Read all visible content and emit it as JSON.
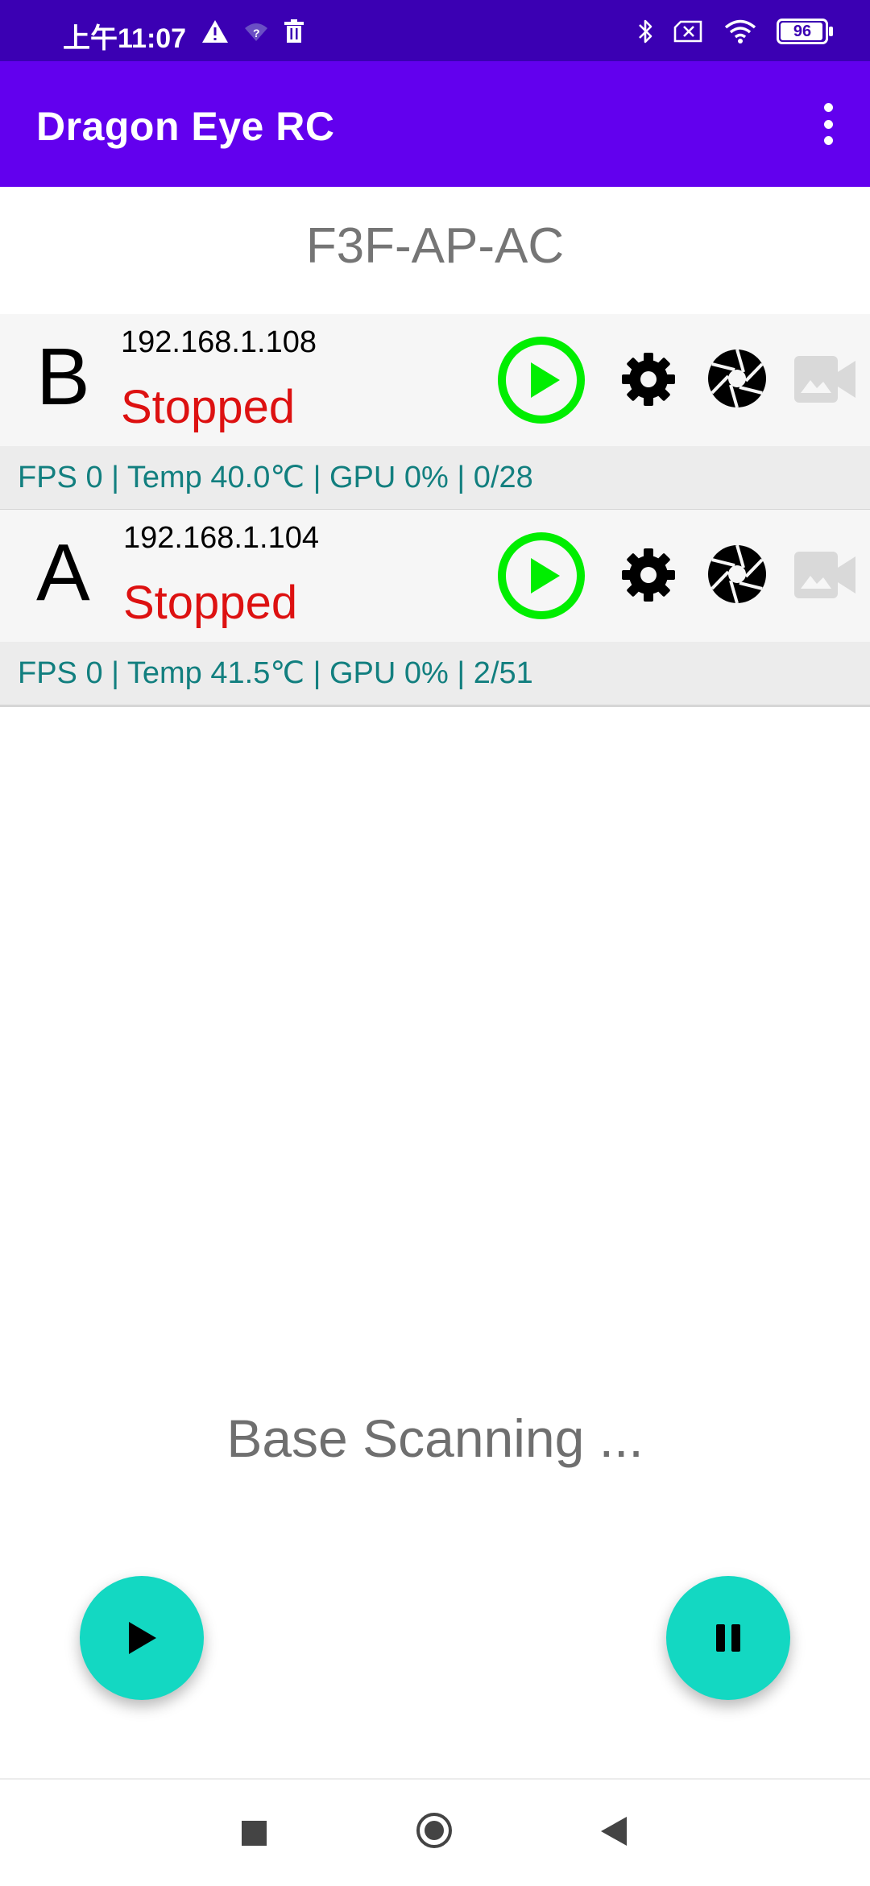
{
  "status_bar": {
    "time": "上午11:07",
    "battery": "96"
  },
  "app_bar": {
    "title": "Dragon Eye RC"
  },
  "network_name": "F3F-AP-AC",
  "devices": [
    {
      "letter": "B",
      "ip": "192.168.1.108",
      "status": "Stopped",
      "stats": "FPS 0 | Temp 40.0℃ | GPU 0% | 0/28"
    },
    {
      "letter": "A",
      "ip": "192.168.1.104",
      "status": "Stopped",
      "stats": "FPS 0 | Temp 41.5℃ | GPU 0% | 2/51"
    }
  ],
  "scan_status": "Base Scanning ...",
  "colors": {
    "status_bar": "#3b00b3",
    "app_bar": "#6200ee",
    "status_stopped": "#dd1111",
    "play_green": "#00ee00",
    "stats_teal": "#127f7f",
    "fab": "#13d8c2"
  },
  "icons": {
    "device_actions": [
      "play-circle-icon",
      "gear-icon",
      "camera-shutter-icon",
      "video-camera-icon"
    ],
    "fabs": [
      "play-icon",
      "pause-icon"
    ],
    "nav": [
      "recents-square-icon",
      "home-circle-icon",
      "back-triangle-icon"
    ]
  }
}
